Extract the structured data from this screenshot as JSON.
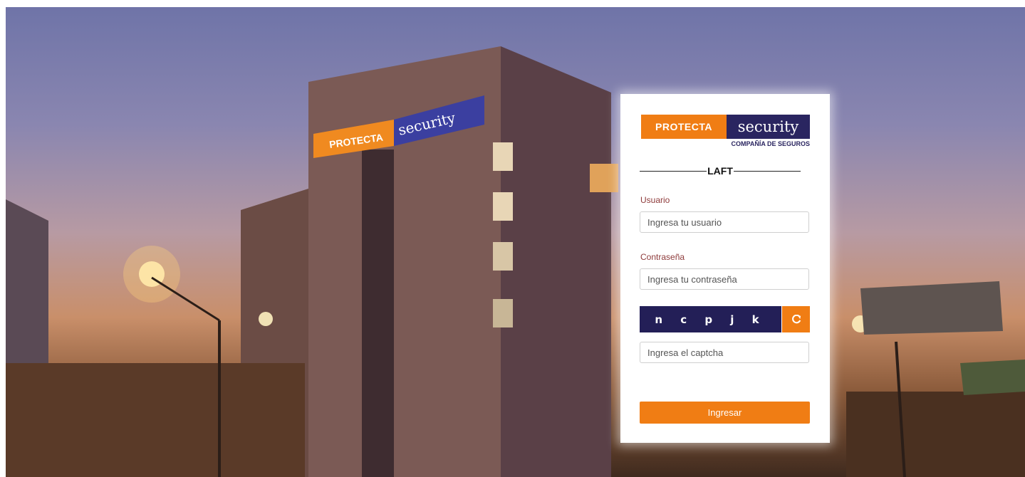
{
  "logo": {
    "left_text": "PROTECTA",
    "right_text": "security",
    "subtitle": "COMPAÑÍA DE SEGUROS",
    "orange": "#f07d14",
    "navy": "#2a2560"
  },
  "section_title": "LAFT",
  "form": {
    "user_label": "Usuario",
    "user_placeholder": "Ingresa tu usuario",
    "password_label": "Contraseña",
    "password_placeholder": "Ingresa tu contraseña",
    "captcha_text": "n c p j k",
    "refresh_icon": "refresh-icon",
    "captcha_placeholder": "Ingresa el captcha",
    "submit_label": "Ingresar"
  },
  "background": {
    "sign_left": "PROTECTA",
    "sign_right": "security"
  }
}
